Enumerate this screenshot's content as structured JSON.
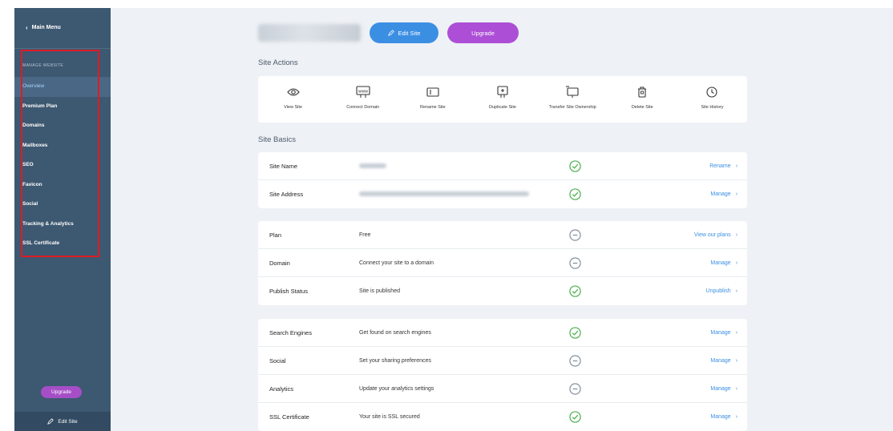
{
  "sidebar": {
    "main_menu_label": "Main Menu",
    "section_label": "MANAGE WEBSITE",
    "items": [
      {
        "label": "Overview"
      },
      {
        "label": "Premium Plan"
      },
      {
        "label": "Domains"
      },
      {
        "label": "Mailboxes"
      },
      {
        "label": "SEO"
      },
      {
        "label": "Favicon"
      },
      {
        "label": "Social"
      },
      {
        "label": "Tracking & Analytics"
      },
      {
        "label": "SSL Certificate"
      }
    ],
    "active_item": "Overview",
    "upgrade_label": "Upgrade",
    "edit_site_label": "Edit Site"
  },
  "header": {
    "edit_site_label": "Edit Site",
    "upgrade_label": "Upgrade"
  },
  "site_actions": {
    "title": "Site Actions",
    "items": [
      {
        "label": "View Site",
        "icon": "eye-icon"
      },
      {
        "label": "Connect Domain",
        "icon": "domain-icon"
      },
      {
        "label": "Rename Site",
        "icon": "rename-icon"
      },
      {
        "label": "Duplicate Site",
        "icon": "duplicate-icon"
      },
      {
        "label": "Transfer Site Ownership",
        "icon": "transfer-icon"
      },
      {
        "label": "Delete Site",
        "icon": "trash-icon"
      },
      {
        "label": "Site History",
        "icon": "clock-icon"
      }
    ]
  },
  "site_basics": {
    "title": "Site Basics",
    "rows": [
      {
        "label": "Site Name",
        "status": "check",
        "action": "Rename"
      },
      {
        "label": "Site Address",
        "status": "check",
        "action": "Manage"
      }
    ]
  },
  "plan_card": {
    "rows": [
      {
        "label": "Plan",
        "value": "Free",
        "status": "minus",
        "action": "View our plans"
      },
      {
        "label": "Domain",
        "value": "Connect your site to a domain",
        "status": "minus",
        "action": "Manage"
      },
      {
        "label": "Publish Status",
        "value": "Site is published",
        "status": "check",
        "action": "Unpublish"
      }
    ]
  },
  "settings_card": {
    "rows": [
      {
        "label": "Search Engines",
        "value": "Get found on search engines",
        "status": "check",
        "action": "Manage"
      },
      {
        "label": "Social",
        "value": "Set your sharing preferences",
        "status": "minus",
        "action": "Manage"
      },
      {
        "label": "Analytics",
        "value": "Update your analytics settings",
        "status": "minus",
        "action": "Manage"
      },
      {
        "label": "SSL Certificate",
        "value": "Your site is SSL secured",
        "status": "check",
        "action": "Manage"
      }
    ]
  },
  "colors": {
    "sidebar": "#3d5871",
    "accent_blue": "#3b8fe3",
    "accent_purple": "#ad4fd6",
    "status_ok": "#4caf50",
    "status_neutral": "#7b8794",
    "highlight_box": "#e01b24"
  }
}
